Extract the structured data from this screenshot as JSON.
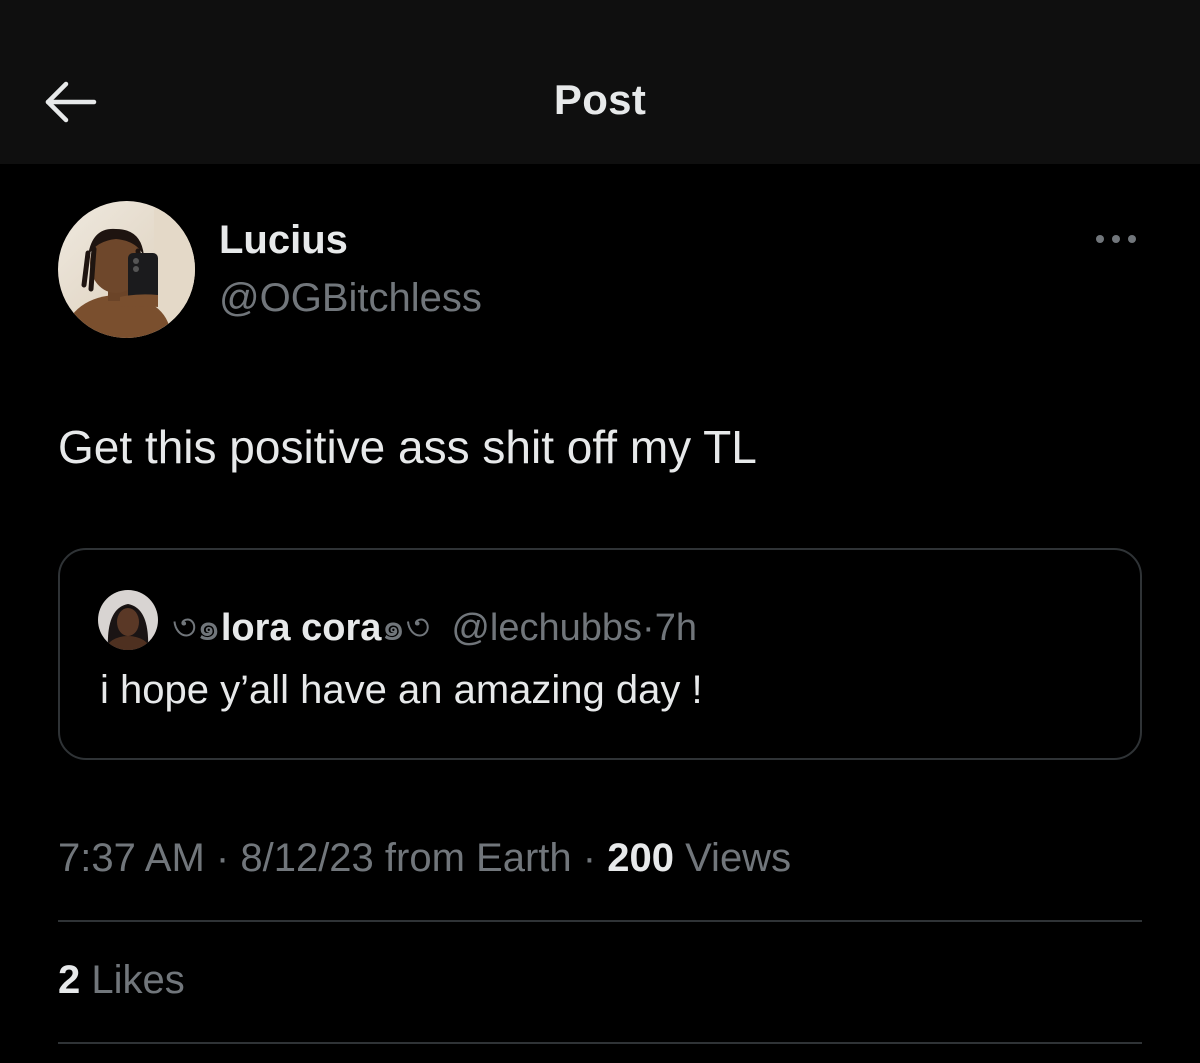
{
  "header": {
    "title": "Post",
    "back_icon": "arrow-left-icon"
  },
  "post": {
    "author": {
      "name": "Lucius",
      "handle": "@OGBitchless",
      "avatar_icon": "user-avatar"
    },
    "more_icon": "more-horizontal-icon",
    "text": "Get this positive ass shit off my TL",
    "quote": {
      "name": "lora cora",
      "name_left_ornament": "৩๑",
      "name_right_ornament": "๑৩",
      "handle": "@lechubbs",
      "separator": "·",
      "time": "7h",
      "text": "i hope y’all have an amazing day !",
      "avatar_icon": "user-avatar"
    },
    "meta": {
      "time": "7:37 AM",
      "separator": "·",
      "date": "8/12/23 from Earth",
      "views_count": "200",
      "views_label": "Views"
    },
    "likes": {
      "count": "2",
      "label": "Likes"
    }
  },
  "colors": {
    "background": "#000000",
    "header_bg": "#0f0f0f",
    "primary_text": "#e7e9ea",
    "secondary_text": "#71767b",
    "border": "#2f3336"
  }
}
